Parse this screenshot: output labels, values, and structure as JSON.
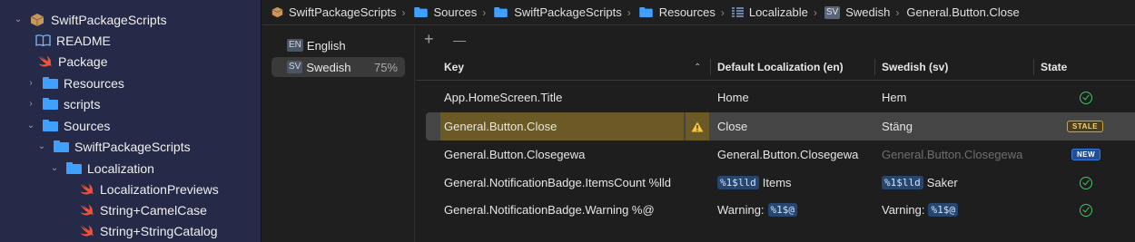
{
  "navigator": {
    "items": [
      {
        "label": "SwiftPackageScripts",
        "icon": "package-icon",
        "expanded": true
      },
      {
        "label": "README",
        "icon": "book-icon"
      },
      {
        "label": "Package",
        "icon": "swift-file-icon"
      },
      {
        "label": "Resources",
        "icon": "folder-icon",
        "expanded": false
      },
      {
        "label": "scripts",
        "icon": "folder-icon",
        "expanded": false
      },
      {
        "label": "Sources",
        "icon": "folder-icon",
        "expanded": true
      },
      {
        "label": "SwiftPackageScripts",
        "icon": "folder-icon",
        "expanded": true
      },
      {
        "label": "Localization",
        "icon": "folder-icon",
        "expanded": true
      },
      {
        "label": "LocalizationPreviews",
        "icon": "swift-file-icon"
      },
      {
        "label": "String+CamelCase",
        "icon": "swift-file-icon"
      },
      {
        "label": "String+StringCatalog",
        "icon": "swift-file-icon"
      }
    ]
  },
  "breadcrumb": {
    "items": [
      {
        "label": "SwiftPackageScripts",
        "icon": "package-icon"
      },
      {
        "label": "Sources",
        "icon": "folder-icon"
      },
      {
        "label": "SwiftPackageScripts",
        "icon": "folder-icon"
      },
      {
        "label": "Resources",
        "icon": "folder-icon"
      },
      {
        "label": "Localizable",
        "icon": "string-catalog-icon"
      },
      {
        "label": "Swedish",
        "icon": "language-icon",
        "code": "SV"
      },
      {
        "label": "General.Button.Close"
      }
    ]
  },
  "languages": [
    {
      "code": "EN",
      "name": "English",
      "percent": ""
    },
    {
      "code": "SV",
      "name": "Swedish",
      "percent": "75%",
      "selected": true
    }
  ],
  "toolbar": {
    "add_label": "+",
    "remove_label": "—"
  },
  "table": {
    "columns": [
      "Key",
      "Default Localization (en)",
      "Swedish (sv)",
      "State"
    ],
    "rows": [
      {
        "key": "App.HomeScreen.Title",
        "default": "Home",
        "translation": "Hem",
        "state": "translated"
      },
      {
        "key": "General.Button.Close",
        "default": "Close",
        "translation": "Stäng",
        "state": "STALE",
        "warning": true,
        "selected": true
      },
      {
        "key": "General.Button.Closegewa",
        "default": "General.Button.Closegewa",
        "translation": "General.Button.Closegewa",
        "state": "NEW"
      },
      {
        "key": "General.NotificationBadge.ItemsCount %lld",
        "default_token": "%1$lld",
        "default_text": "Items",
        "translation_token": "%1$lld",
        "translation_text": "Saker",
        "state": "translated"
      },
      {
        "key": "General.NotificationBadge.Warning %@",
        "default_text": "Warning:",
        "default_token": "%1$@",
        "translation_text": "Varning:",
        "translation_token": "%1$@",
        "state": "translated"
      }
    ]
  },
  "colors": {
    "accent": "#3fa0ff",
    "stale": "#c9a73e",
    "new": "#1f4f9a",
    "ok": "#40c463",
    "highlight": "#6b5a25"
  }
}
